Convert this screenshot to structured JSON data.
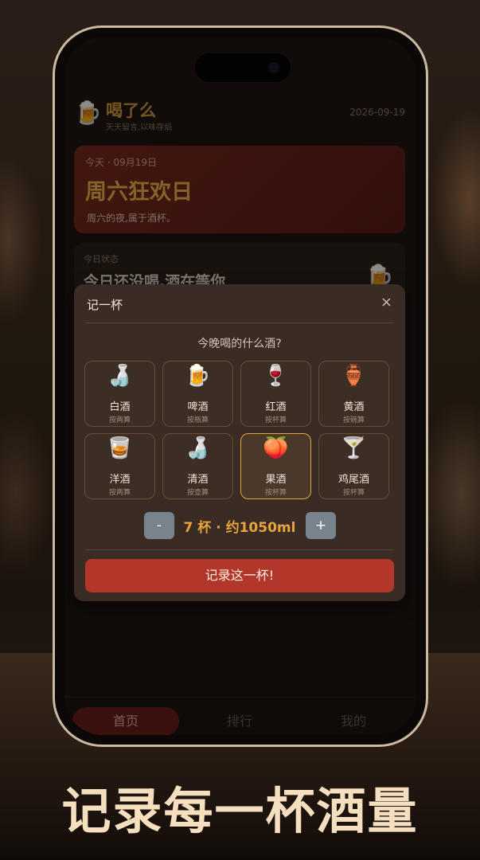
{
  "header": {
    "app_icon": "beer-mug-icon",
    "app_title": "喝了么",
    "app_subtitle": "天天留言,以味存焰",
    "date": "2026-09-19"
  },
  "hero": {
    "date_line": "今天 · 09月19日",
    "title": "周六狂欢日",
    "description": "周六的夜,属于酒杯。"
  },
  "status_card": {
    "label": "今日状态",
    "text": "今日还没喝,酒在等你",
    "icon": "beer-mug-icon"
  },
  "modal": {
    "title": "记一杯",
    "close_symbol": "×",
    "question": "今晚喝的什么酒?",
    "drinks": [
      {
        "name": "白酒",
        "unit": "按两算",
        "icon": "baijiu-bottle-icon",
        "glyph": "🍶"
      },
      {
        "name": "啤酒",
        "unit": "按瓶算",
        "icon": "beer-mug-icon",
        "glyph": "🍺"
      },
      {
        "name": "红酒",
        "unit": "按杯算",
        "icon": "wine-glass-icon",
        "glyph": "🍷"
      },
      {
        "name": "黄酒",
        "unit": "按碗算",
        "icon": "huangjiu-jar-icon",
        "glyph": "🏺"
      },
      {
        "name": "洋酒",
        "unit": "按两算",
        "icon": "whisky-icon",
        "glyph": "🥃"
      },
      {
        "name": "清酒",
        "unit": "按壶算",
        "icon": "sake-icon",
        "glyph": "🍶"
      },
      {
        "name": "果酒",
        "unit": "按杯算",
        "icon": "fruit-wine-icon",
        "glyph": "🍑"
      },
      {
        "name": "鸡尾酒",
        "unit": "按杯算",
        "icon": "cocktail-icon",
        "glyph": "🍸"
      }
    ],
    "selected_drink": "果酒",
    "minus_label": "-",
    "plus_label": "+",
    "quantity_text": "7 杯 · 约1050ml",
    "submit_label": "记录这一杯!"
  },
  "tabs": [
    {
      "label": "首页",
      "active": true
    },
    {
      "label": "排行",
      "active": false
    },
    {
      "label": "我的",
      "active": false
    }
  ],
  "caption": "记录每一杯酒量",
  "colors": {
    "accent_gold": "#e3a93b",
    "primary_red": "#b3362a",
    "modal_bg": "#3a2c24"
  }
}
